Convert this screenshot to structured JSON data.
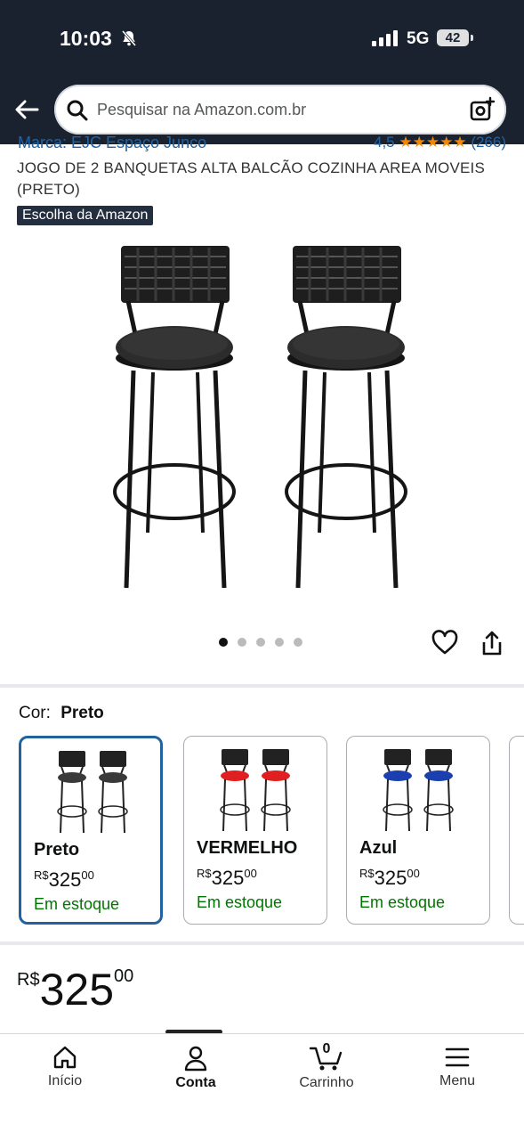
{
  "status_bar": {
    "time": "10:03",
    "network": "5G",
    "battery": "42"
  },
  "search": {
    "placeholder": "Pesquisar na Amazon.com.br"
  },
  "product": {
    "brand_text": "Marca: EJC Espaço Junco",
    "rating_value": "4,5",
    "rating_count": "(266)",
    "title": "JOGO DE 2 BANQUETAS ALTA BALCÃO COZINHA AREA MOVEIS (PRETO)",
    "badge": "Escolha da Amazon",
    "image_count": 5,
    "active_image": 1
  },
  "color": {
    "label": "Cor:",
    "selected": "Preto",
    "options": [
      {
        "name": "Preto",
        "currency": "R$",
        "whole": "325",
        "cents": "00",
        "stock": "Em estoque",
        "seat_color": "#3a3a3a"
      },
      {
        "name": "VERMELHO",
        "currency": "R$",
        "whole": "325",
        "cents": "00",
        "stock": "Em estoque",
        "seat_color": "#e02020"
      },
      {
        "name": "Azul",
        "currency": "R$",
        "whole": "325",
        "cents": "00",
        "stock": "Em estoque",
        "seat_color": "#1c3fb0"
      }
    ]
  },
  "price": {
    "currency": "R$",
    "whole": "325",
    "cents": "00"
  },
  "nav": {
    "home": "Início",
    "account": "Conta",
    "cart": "Carrinho",
    "cart_count": "0",
    "menu": "Menu"
  },
  "colors": {
    "header_bg": "#1a2230",
    "link": "#2162a1",
    "in_stock": "#007600",
    "selected_border": "#2162a1"
  }
}
